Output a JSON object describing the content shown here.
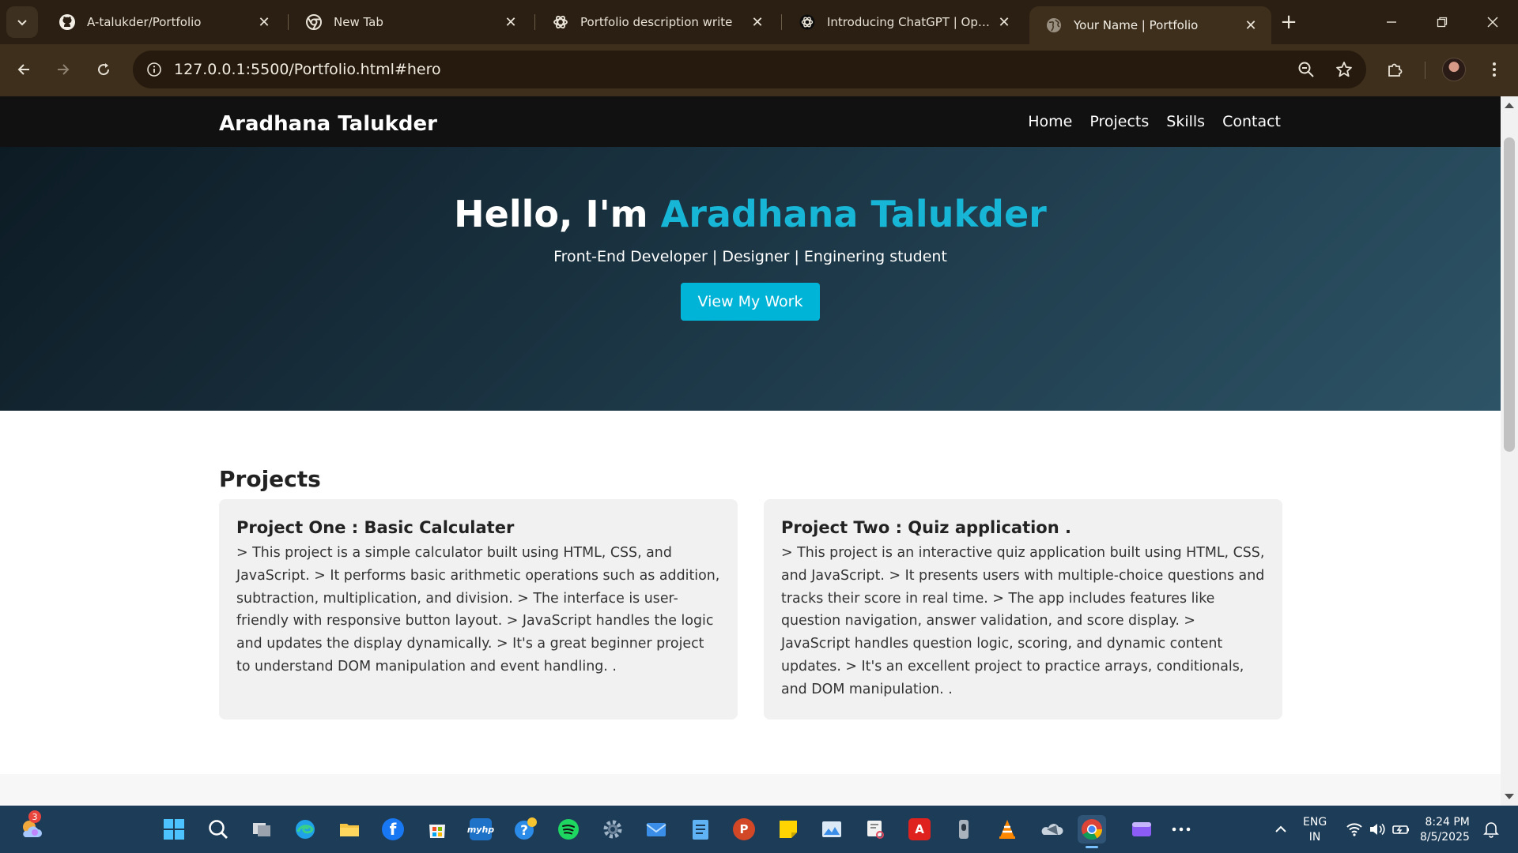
{
  "browser": {
    "tabs": [
      {
        "title": "A-talukder/Portfolio",
        "icon": "github-icon",
        "active": false
      },
      {
        "title": "New Tab",
        "icon": "chrome-icon",
        "active": false
      },
      {
        "title": "Portfolio description write",
        "icon": "openai-icon",
        "active": false
      },
      {
        "title": "Introducing ChatGPT | OpenAI",
        "icon": "openai-icon",
        "active": false
      },
      {
        "title": "Your Name | Portfolio",
        "icon": "globe-icon",
        "active": true
      }
    ],
    "url": "127.0.0.1:5500/Portfolio.html#hero"
  },
  "site": {
    "brand": "Aradhana Talukder",
    "nav": [
      "Home",
      "Projects",
      "Skills",
      "Contact"
    ],
    "hero": {
      "greeting": "Hello, I'm",
      "name": "Aradhana Talukder",
      "subtitle": "Front-End Developer | Designer | Enginering student",
      "cta": "View My Work"
    },
    "projects": {
      "heading": "Projects",
      "items": [
        {
          "title": "Project One : Basic Calculater",
          "description": "> This project is a simple calculator built using HTML, CSS, and JavaScript. > It performs basic arithmetic operations such as addition, subtraction, multiplication, and division. > The interface is user-friendly with responsive button layout. > JavaScript handles the logic and updates the display dynamically. > It's a great beginner project to understand DOM manipulation and event handling. ."
        },
        {
          "title": "Project Two : Quiz application .",
          "description": "> This project is an interactive quiz application built using HTML, CSS, and JavaScript. > It presents users with multiple-choice questions and tracks their score in real time. > The app includes features like question navigation, answer validation, and score display. > JavaScript handles question logic, scoring, and dynamic content updates. > It's an excellent project to practice arrays, conditionals, and DOM manipulation. ."
        }
      ]
    }
  },
  "taskbar": {
    "weather_badge": "3",
    "language": {
      "line1": "ENG",
      "line2": "IN"
    },
    "time": "8:24 PM",
    "date": "8/5/2025",
    "apps": [
      "windows-start-icon",
      "search-icon",
      "task-view-icon",
      "edge-icon",
      "file-explorer-icon",
      "facebook-icon",
      "microsoft-store-icon",
      "myhp-icon",
      "help-icon",
      "spotify-icon",
      "settings-icon",
      "mail-icon",
      "notepad-icon",
      "powerpoint-icon",
      "sticky-notes-icon",
      "photos-icon",
      "snipping-tool-icon",
      "acrobat-icon",
      "voice-recorder-icon",
      "vlc-icon",
      "onedrive-icon",
      "chrome-icon",
      "clipchamp-icon",
      "more-apps-icon"
    ]
  },
  "colors": {
    "accent": "#00b4d8",
    "hero_name": "#17b5d6",
    "site_nav_bg": "#111111",
    "chrome_bg": "#3d2f1c",
    "taskbar_bg": "#1d3c58"
  }
}
